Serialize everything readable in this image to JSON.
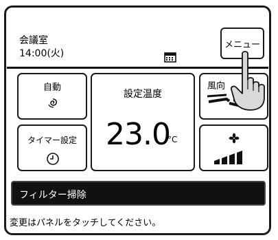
{
  "header": {
    "room_name": "会議室",
    "clock": "14:00(火)",
    "menu_label": "メニュー"
  },
  "controls": {
    "auto_label": "自動",
    "timer_label": "タイマー設定",
    "temp_title": "設定温度",
    "temp_value": "23.0",
    "temp_unit": "°C",
    "wind_dir_label": "風向"
  },
  "notice": {
    "text": "フィルター掃除"
  },
  "footer": {
    "help_text": "変更はパネルをタッチしてください。"
  },
  "icons": {
    "auto": "swirl-icon",
    "timer": "clock-icon",
    "fan": "fan-icon",
    "fan_level": "fan-speed-bars-icon",
    "wind_direction": "louver-direction-icon",
    "calendar": "calendar-icon",
    "hand": "pointing-hand-icon"
  },
  "colors": {
    "frame": "#1a1a1a",
    "notice_bg": "#111111",
    "notice_text": "#ffffff"
  }
}
